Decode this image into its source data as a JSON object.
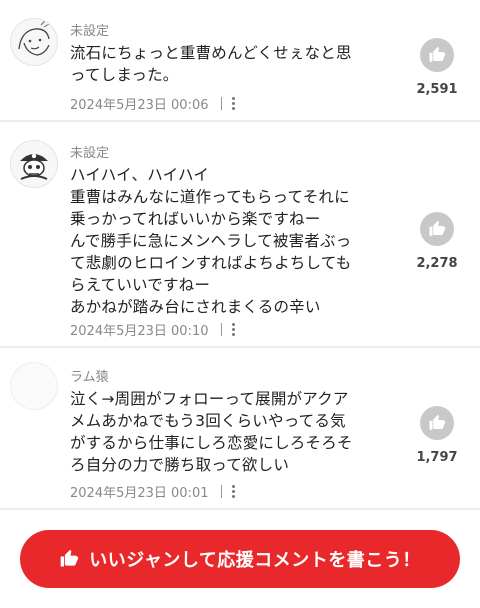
{
  "comments": [
    {
      "username": "未設定",
      "avatar_icon": "doodle-face-icon",
      "text": "流石にちょっと重曹めんどくせぇなと思\nってしまった。",
      "date": "2024年5月23日 00:06",
      "likes": "2,591"
    },
    {
      "username": "未設定",
      "avatar_icon": "pirate-skull-icon",
      "text": "ハイハイ、ハイハイ\n重曹はみんなに道作ってもらってそれに\n乗っかってればいいから楽ですねー\nんで勝手に急にメンヘラして被害者ぶっ\nて悲劇のヒロインすればよちよちしても\nらえていいですねー\nあかねが踏み台にされまくるの辛い",
      "date": "2024年5月23日 00:10",
      "likes": "2,278"
    },
    {
      "username": "ラム猿",
      "avatar_icon": "blank-avatar-icon",
      "text": "泣く→周囲がフォローって展開がアクア\nメムあかねでもう3回くらいやってる気\nがするから仕事にしろ恋愛にしろそろそ\nろ自分の力で勝ち取って欲しい",
      "date": "2024年5月23日 00:01",
      "likes": "1,797"
    }
  ],
  "cta": {
    "label": "いいジャンして応援コメントを書こう！",
    "color": "#e8282a"
  }
}
